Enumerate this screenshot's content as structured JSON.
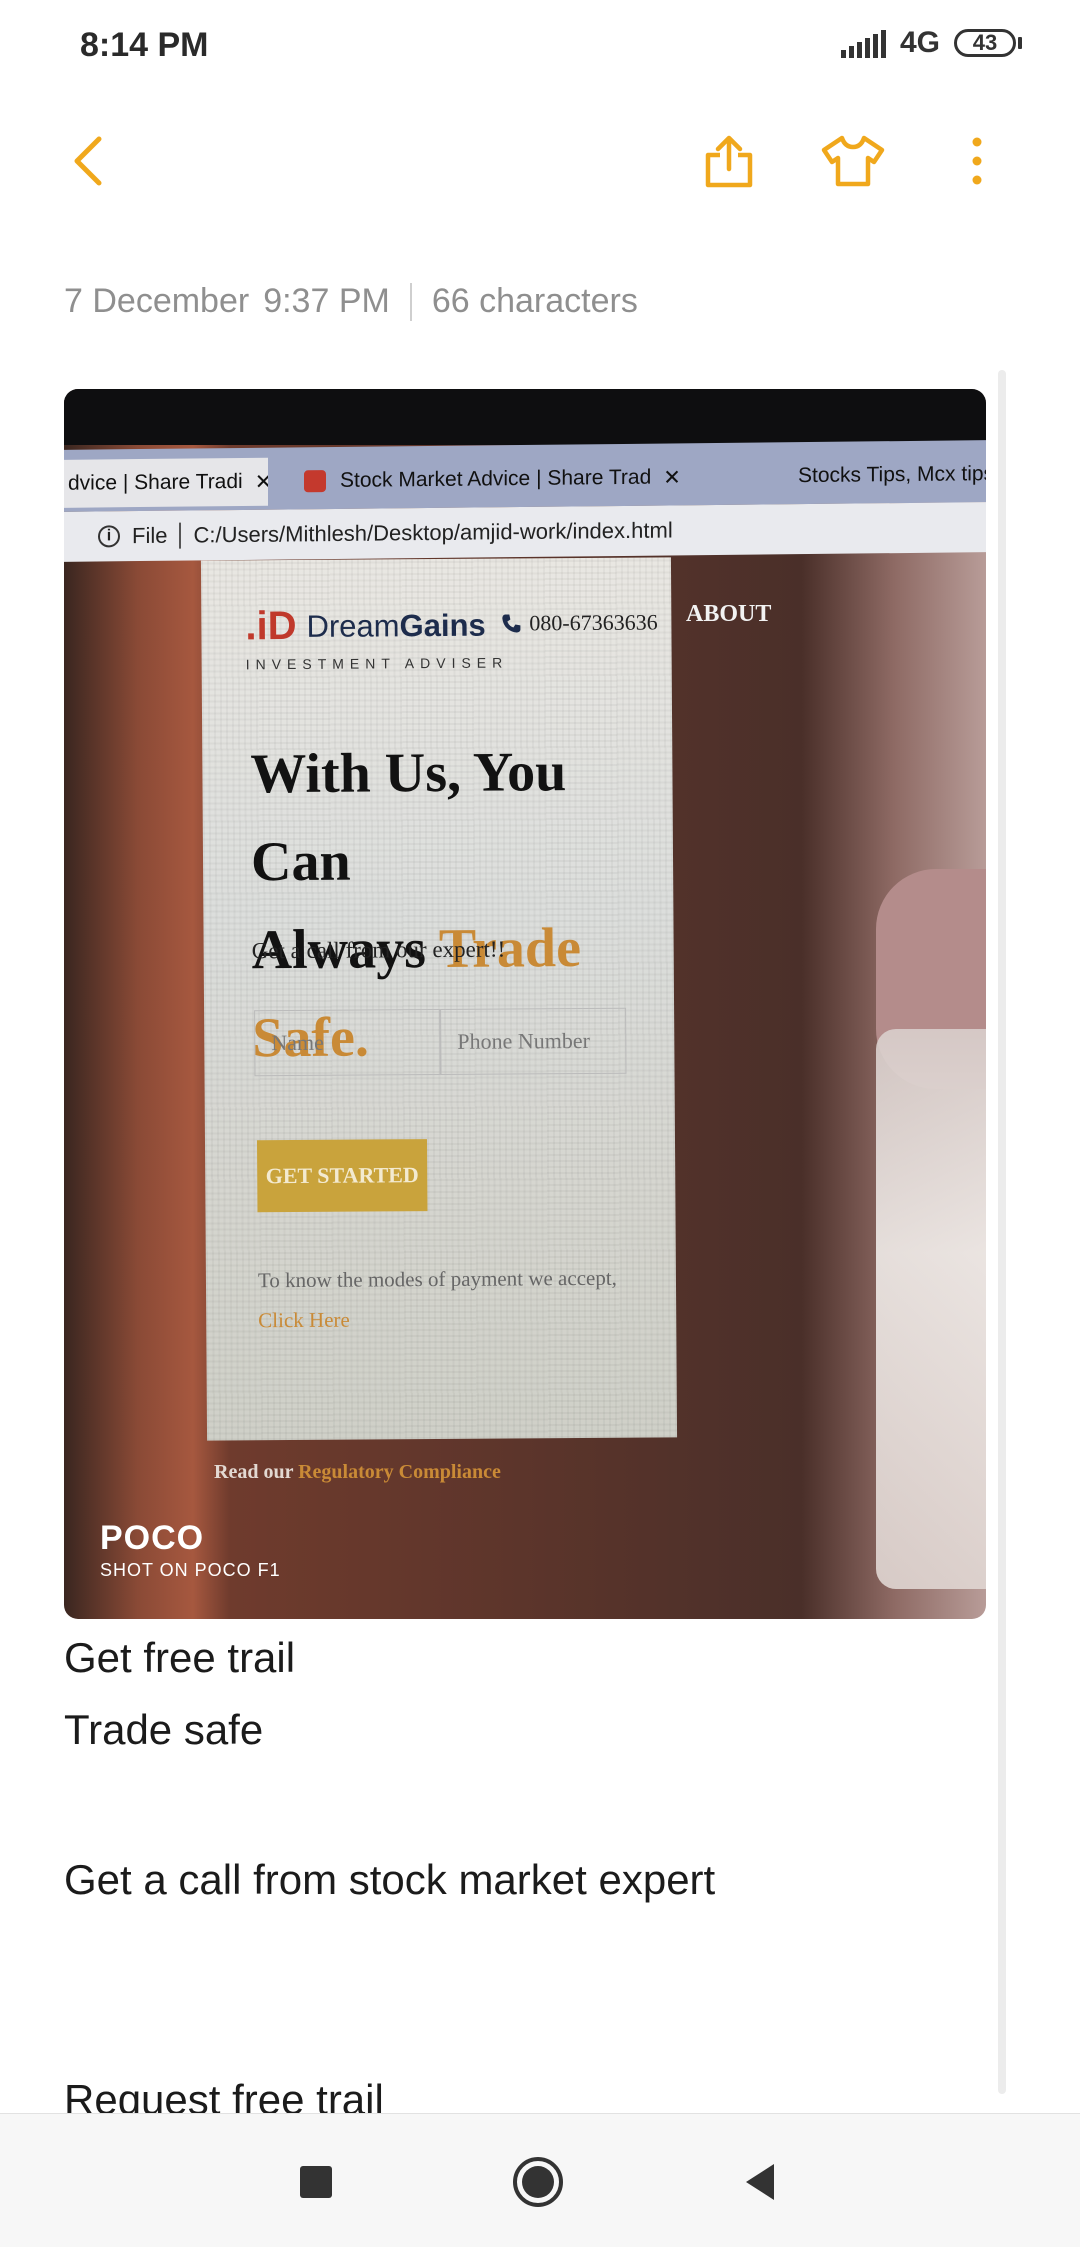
{
  "status_bar": {
    "time": "8:14 PM",
    "network": "4G",
    "battery": "43"
  },
  "toolbar": {
    "back_icon": "chevron-left-icon",
    "share_icon": "share-icon",
    "theme_icon": "tshirt-icon",
    "more_icon": "more-vertical-icon",
    "accent_color": "#f0a81c"
  },
  "note": {
    "date": "7 December",
    "time": "9:37 PM",
    "char_count": "66 characters",
    "lines": [
      "Get free trail",
      "Trade safe",
      "Get a call from stock market expert",
      "Request free trail"
    ]
  },
  "photo": {
    "tabs": [
      {
        "label": "dvice | Share Tradi",
        "close": "✕"
      },
      {
        "label": "Stock Market Advice | Share Trad",
        "close": "✕"
      },
      {
        "label": "Stocks Tips, Mcx tips, In"
      }
    ],
    "address": {
      "scheme": "File",
      "path": "C:/Users/Mithlesh/Desktop/amjid-work/index.html"
    },
    "site": {
      "logo_mark": ".iD",
      "brand_first": "Dream",
      "brand_second": "Gains",
      "tagline": "INVESTMENT ADVISER",
      "phone": "080-67363636",
      "nav_about": "ABOUT",
      "hero_line1": "With Us, You Can",
      "hero_line2_plain": "Always ",
      "hero_line2_accent": "Trade Safe.",
      "cta_text": "Get a call from our expert!!",
      "name_placeholder": "Name",
      "phone_placeholder": "Phone Number",
      "button": "GET STARTED",
      "payment_text": "To know the modes of payment we accept,",
      "payment_link": "Click Here",
      "regulatory_text": "Read our",
      "regulatory_link": "Regulatory Compliance"
    },
    "watermark": {
      "brand": "POCO",
      "sub": "SHOT ON POCO F1"
    }
  },
  "nav_bar": {
    "recent_icon": "square-icon",
    "home_icon": "circle-icon",
    "back_icon": "triangle-back-icon"
  }
}
